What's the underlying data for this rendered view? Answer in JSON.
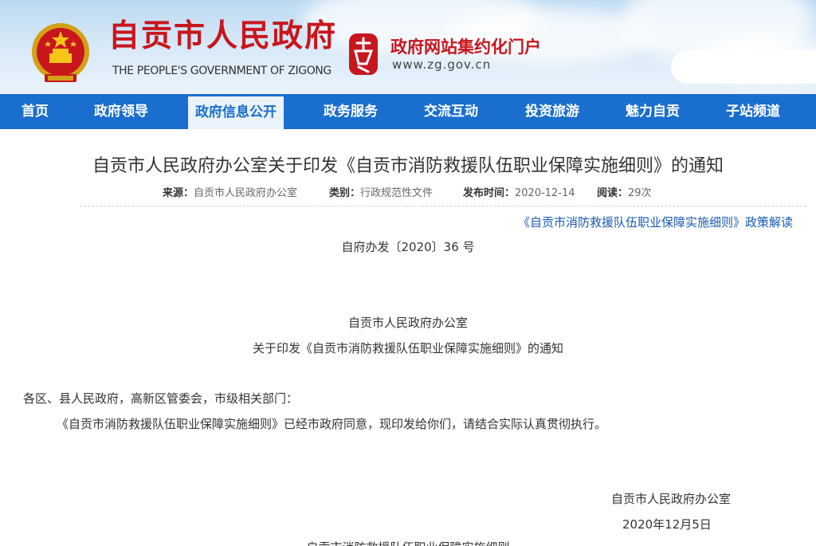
{
  "header": {
    "site_title": "自贡市人民政府",
    "site_subtitle": "THE PEOPLE'S GOVERNMENT OF ZIGONG",
    "portal_title": "政府网站集约化门户",
    "portal_url": "www.zg.gov.cn",
    "search_value": "",
    "icons": [
      "national-emblem-icon",
      "zigong-logo-icon"
    ]
  },
  "nav": {
    "items": [
      {
        "label": "首页"
      },
      {
        "label": "政府领导"
      },
      {
        "label": "政府信息公开"
      },
      {
        "label": "政务服务"
      },
      {
        "label": "交流互动"
      },
      {
        "label": "投资旅游"
      },
      {
        "label": "魅力自贡"
      },
      {
        "label": "子站频道"
      }
    ],
    "active_label": "政府信息公开"
  },
  "article": {
    "title": "自贡市人民政府办公室关于印发《自贡市消防救援队伍职业保障实施细则》的通知",
    "meta": {
      "source_label": "来源：",
      "source_value": "自贡市人民政府办公室",
      "category_label": "类别：",
      "category_value": "行政规范性文件",
      "date_label": "发布时间：",
      "date_value": "2020-12-14",
      "views_label": "阅读：",
      "views_value": "29次"
    },
    "policy_link": "《自贡市消防救援队伍职业保障实施细则》政策解读",
    "doc_number": "自府办发〔2020〕36 号",
    "issuer": "自贡市人民政府办公室",
    "subject": "关于印发《自贡市消防救援队伍职业保障实施细则》的通知",
    "recipients": "各区、县人民政府，高新区管委会，市级相关部门：",
    "body": "《自贡市消防救援队伍职业保障实施细则》已经市政府同意，现印发给你们，请结合实际认真贯彻执行。",
    "signature": "自贡市人民政府办公室",
    "sign_date": "2020年12月5日",
    "attachment_title": "自贡市消防救援队伍职业保障实施细则"
  },
  "colors": {
    "brand_red": "#c8161d",
    "nav_blue": "#1a6ecd",
    "link_blue": "#1a5ab4"
  }
}
